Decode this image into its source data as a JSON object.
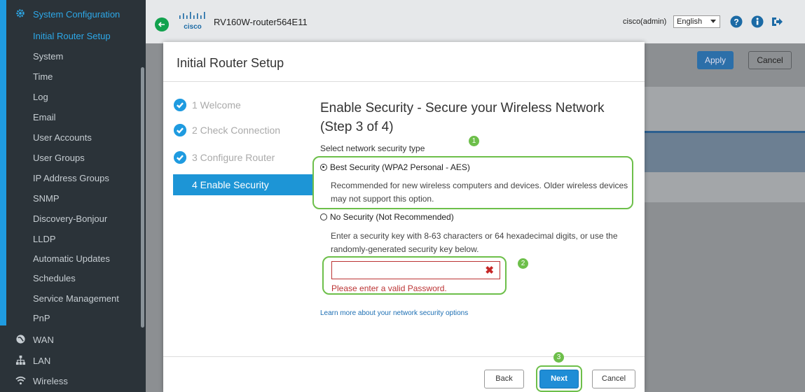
{
  "sidebar": {
    "section_title": "System Configuration",
    "items": [
      {
        "label": "Initial Router Setup"
      },
      {
        "label": "System"
      },
      {
        "label": "Time"
      },
      {
        "label": "Log"
      },
      {
        "label": "Email"
      },
      {
        "label": "User Accounts"
      },
      {
        "label": "User Groups"
      },
      {
        "label": "IP Address Groups"
      },
      {
        "label": "SNMP"
      },
      {
        "label": "Discovery-Bonjour"
      },
      {
        "label": "LLDP"
      },
      {
        "label": "Automatic Updates"
      },
      {
        "label": "Schedules"
      },
      {
        "label": "Service Management"
      },
      {
        "label": "PnP"
      }
    ],
    "sections": [
      {
        "label": "WAN",
        "icon": "globe-icon"
      },
      {
        "label": "LAN",
        "icon": "network-icon"
      },
      {
        "label": "Wireless",
        "icon": "wifi-icon"
      }
    ]
  },
  "header": {
    "device_name": "RV160W-router564E11",
    "user": "cisco(admin)",
    "language": "English"
  },
  "background": {
    "apply_label": "Apply",
    "cancel_label": "Cancel"
  },
  "modal": {
    "title": "Initial Router Setup",
    "steps": [
      {
        "label": "1 Welcome"
      },
      {
        "label": "2 Check Connection"
      },
      {
        "label": "3 Configure Router"
      },
      {
        "label": "4 Enable Security"
      }
    ],
    "heading": "Enable Security - Secure your Wireless Network (Step 3 of 4)",
    "select_label": "Select network security type",
    "option_best": "Best Security (WPA2 Personal - AES)",
    "option_best_desc": "Recommended for new wireless computers and devices. Older wireless devices may not support this option.",
    "option_none": "No Security (Not Recommended)",
    "key_help": "Enter a security key with 8-63 characters or 64 hexadecimal digits, or use the randomly-generated security key below.",
    "password_value": "",
    "password_error": "Please enter a valid Password.",
    "learn_more": "Learn more about your network security options",
    "back_label": "Back",
    "next_label": "Next",
    "cancel_label": "Cancel"
  },
  "badges": [
    "1",
    "2",
    "3"
  ],
  "colors": {
    "accent": "#1f9be0",
    "highlight": "#6dbf4a",
    "error": "#b33333",
    "sidebar_bg": "#2b3339"
  }
}
